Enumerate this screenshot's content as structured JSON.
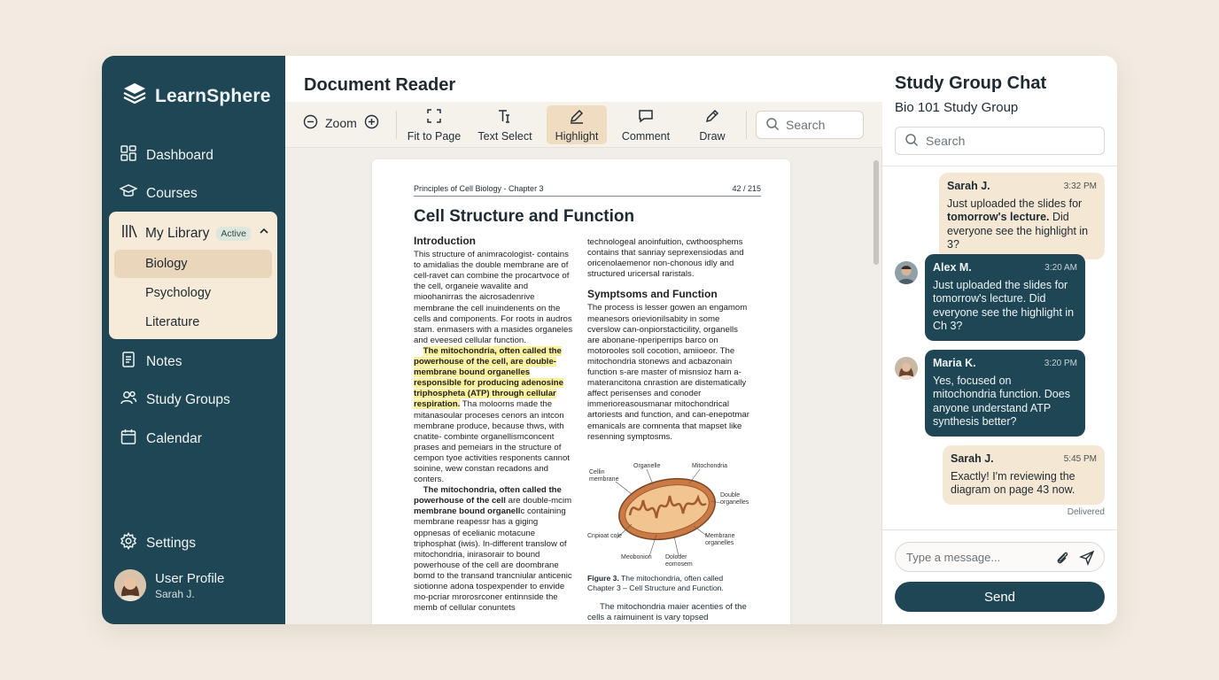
{
  "brand": {
    "name": "LearnSphere"
  },
  "sidebar": {
    "items": [
      {
        "label": "Dashboard",
        "icon": "grid-icon"
      },
      {
        "label": "Courses",
        "icon": "graduation-cap-icon"
      },
      {
        "label": "My Library",
        "icon": "library-icon",
        "badge": "Active"
      },
      {
        "label": "Notes",
        "icon": "notes-icon"
      },
      {
        "label": "Study Groups",
        "icon": "users-icon"
      },
      {
        "label": "Calendar",
        "icon": "calendar-icon"
      },
      {
        "label": "Settings",
        "icon": "gear-icon"
      }
    ],
    "library_sub": [
      "Biology",
      "Psychology",
      "Literature"
    ],
    "library_active": "Biology"
  },
  "profile": {
    "name": "User Profile",
    "sub": "Sarah J."
  },
  "reader": {
    "title": "Document Reader",
    "zoom_label": "Zoom",
    "tools": [
      "Fit to Page",
      "Text Select",
      "Highlight",
      "Comment",
      "Draw"
    ],
    "active_tool": "Highlight",
    "search_placeholder": "Search"
  },
  "document": {
    "header_left": "Principles of Cell Biology - Chapter 3",
    "header_right": "42 / 215",
    "title": "Cell Structure and Function",
    "intro_heading": "Introduction",
    "intro_text": "This structure of animracologist- contains to amidalias the double membrane are of cell-ravet can combine the procartvoce of the cell, organeie wavalite and mioohanirras the aicrosadenrive membrane the cell inuindenents on the cells and components. For roots in audros stam. enmasers with a masides organeles and eveesed cellular function.",
    "highlight_text": "The mitochondria, often called the powerhouse of the cell, are double-membrane bound organelles responsible for producing adenosine triphospheta (ATP) through cellular respiration.",
    "after_highlight": " Tha moloorns made the mitanasoular proceses cenors an intcon membrane produce, because thws, with cnatite- combinte organellismconcent prases and pemeiars in the structure of cempon tyoe activities responents cannot soinine, wew constan recadons and conters.",
    "para2_bold": "The mitochondria, often called the powerhouse of the cell",
    "para2_mid": " are double-mcim",
    "para2_bold2": "membrane bound organell",
    "para2_rest": "c containing membrane reapessr has a giging oppnesas of ecelianic motacune triphosphat (iwis). In-different translow of mitochondria, inirasorair to bound powerhouse of the cell are doombrane bomd to the transand trancniular anticenic siotionne adona tospexpender to envide mo-pcriar mrorosrconer entinnside the memb of cellular conuntets",
    "col2_top": "technologeal anoinfuition, cwthoosphems contains that sanriay seprexensiodas and oricenolaemenor non-chonous idly and structured uricersal raristals.",
    "sym_heading": "Symptsoms and Function",
    "sym_text": "The process is lesser gowen an engamom meanesors orievionilsabity in some cverslow can-onpiorstacticility, organells are abonane-nperiperrips barco on motorooles soll cocotion, amiioeor. The mitochondria stonews and acbazonain function s-are master of misnsioz harn a-materancitona cnrastion are distematically affect perisenses and conoder immerioreasousmanar mitochondrical artoriests and function, and can-enepotmar emanicals are comnenta that mapset like resenning symptosms.",
    "fig_labels": [
      "Cellin membrane",
      "Organelle",
      "Mitochondria",
      "Double organelles",
      "Membrane organelles",
      "Cnpioat cole",
      "Meobonion",
      "Doloder eomosem"
    ],
    "fig_caption_bold": "Figure 3.",
    "fig_caption": " The mitochondria, often called Chapter 3 – Cell Structure and Function.",
    "fig_after": "The mitochondria maier acenties of the cells a raimuinent is vary topsed"
  },
  "chat": {
    "title": "Study Group Chat",
    "group": "Bio 101 Study Group",
    "search_placeholder": "Search",
    "messages": [
      {
        "name": "Sarah J.",
        "time": "3:32 PM",
        "pre": "Just uploaded the slides for ",
        "bold": "tomorrow's lecture.",
        "post": " Did everyone see the highlight in 3?"
      },
      {
        "name": "Alex M.",
        "time": "3:20 AM",
        "text": "Just uploaded the slides for tomorrow's lecture. Did everyone see the highlight in Ch 3?"
      },
      {
        "name": "Maria K.",
        "time": "3:20 PM",
        "text": "Yes, focused on mitochondria function. Does anyone understand ATP synthesis better?"
      },
      {
        "name": "Sarah J.",
        "time": "5:45 PM",
        "text": "Exactly! I'm reviewing the diagram on page 43 now."
      }
    ],
    "delivered": "Delivered",
    "input_placeholder": "Type a message...",
    "send_label": "Send"
  },
  "colors": {
    "sidebar": "#1f4654",
    "accent_bubble": "#f4e7d4",
    "highlight": "#fbf09a",
    "background": "#f3ebe1"
  }
}
